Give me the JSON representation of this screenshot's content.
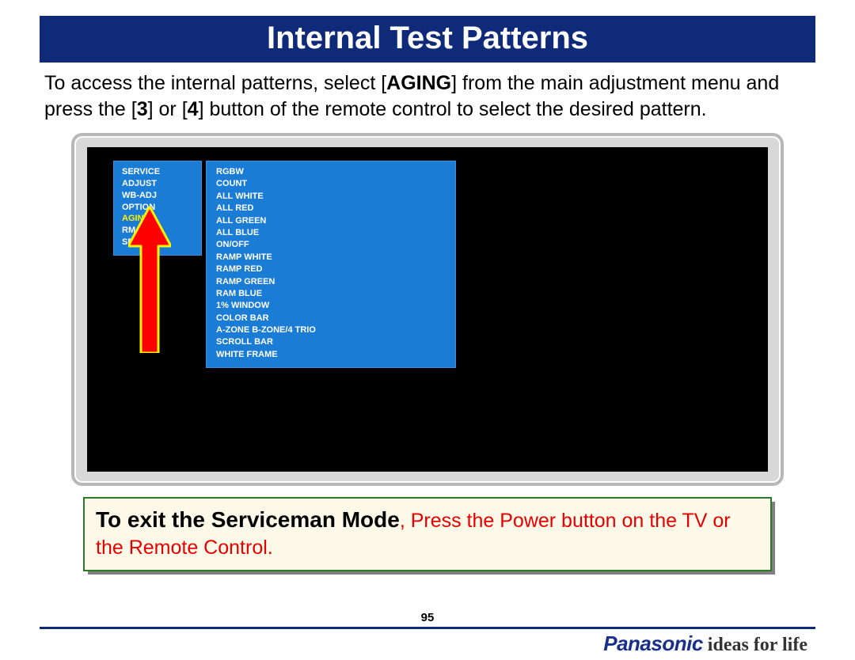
{
  "title": "Internal Test Patterns",
  "intro": {
    "p1a": "To access the internal patterns, select [",
    "p1b": "AGING",
    "p1c": "] from the main adjustment menu and press the [",
    "p1d": "3",
    "p1e": "] or [",
    "p1f": "4",
    "p1g": "] button of the remote control to select the desired pattern."
  },
  "menu_left": [
    "SERVICE",
    "ADJUST",
    "WB-ADJ",
    "OPTION",
    "AGING",
    "RM SET",
    "SRV TOOL"
  ],
  "menu_left_highlight_index": 4,
  "menu_right": [
    "RGBW",
    "COUNT",
    "ALL WHITE",
    "ALL RED",
    "ALL GREEN",
    "ALL BLUE",
    "ON/OFF",
    "RAMP WHITE",
    "RAMP RED",
    "RAMP GREEN",
    "RAM BLUE",
    "1% WINDOW",
    "COLOR BAR",
    "A-ZONE B-ZONE/4 TRIO",
    "SCROLL BAR",
    "WHITE FRAME"
  ],
  "exit": {
    "lead": "To exit the Serviceman Mode",
    "rest": ", Press the Power button on the TV or the Remote Control."
  },
  "page_number": "95",
  "brand": {
    "logo": "Panasonic",
    "tag": "ideas for life"
  }
}
